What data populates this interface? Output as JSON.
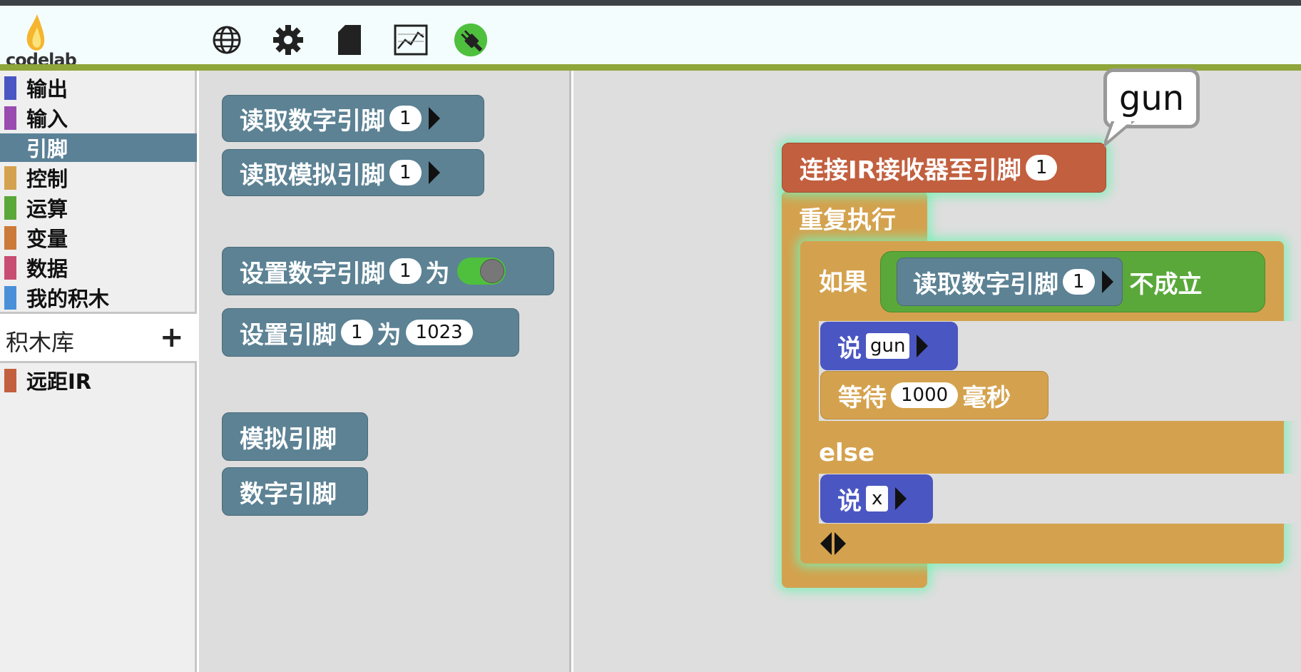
{
  "app": {
    "logo_text": "codelab"
  },
  "toolbar": {
    "icons": [
      "globe-icon",
      "gear-icon",
      "file-icon",
      "chart-icon",
      "usb-plug-icon"
    ]
  },
  "sidebar": {
    "categories": [
      {
        "label": "输出",
        "color": "#4a56c1"
      },
      {
        "label": "输入",
        "color": "#994bb0"
      },
      {
        "label": "引脚",
        "color": "#5b8197",
        "selected": true
      },
      {
        "label": "控制",
        "color": "#d4a24e"
      },
      {
        "label": "运算",
        "color": "#5aa83a"
      },
      {
        "label": "变量",
        "color": "#cc7a3a"
      },
      {
        "label": "数据",
        "color": "#c84d73"
      },
      {
        "label": "我的积木",
        "color": "#4a90d9"
      }
    ],
    "library_label": "积木库",
    "add_symbol": "+",
    "extensions": [
      {
        "label": "远距IR",
        "color": "#c25f3f"
      }
    ]
  },
  "flyout": {
    "read_digital": {
      "label": "读取数字引脚",
      "pin": "1"
    },
    "read_analog": {
      "label": "读取模拟引脚",
      "pin": "1"
    },
    "set_digital": {
      "label": "设置数字引脚",
      "pin": "1",
      "to": "为"
    },
    "set_pin": {
      "label": "设置引脚",
      "pin": "1",
      "to": "为",
      "value": "1023"
    },
    "analog_pin": {
      "label": "模拟引脚"
    },
    "digital_pin": {
      "label": "数字引脚"
    }
  },
  "workspace": {
    "bubble": "gun",
    "connect": {
      "label": "连接IR接收器至引脚",
      "pin": "1"
    },
    "forever": {
      "label": "重复执行"
    },
    "if_block": {
      "label": "如果",
      "cond": "读取数字引脚",
      "pin": "1",
      "not": "不成立"
    },
    "say1": {
      "label": "说",
      "value": "gun"
    },
    "wait": {
      "label": "等待",
      "value": "1000",
      "unit": "毫秒"
    },
    "else_label": "else",
    "say2": {
      "label": "说",
      "value": "x"
    }
  },
  "colors": {
    "pins": "#5c8294",
    "control": "#d4a24e",
    "ir": "#c25f3f",
    "output": "#4a56c1",
    "operators": "#5aa83a"
  }
}
